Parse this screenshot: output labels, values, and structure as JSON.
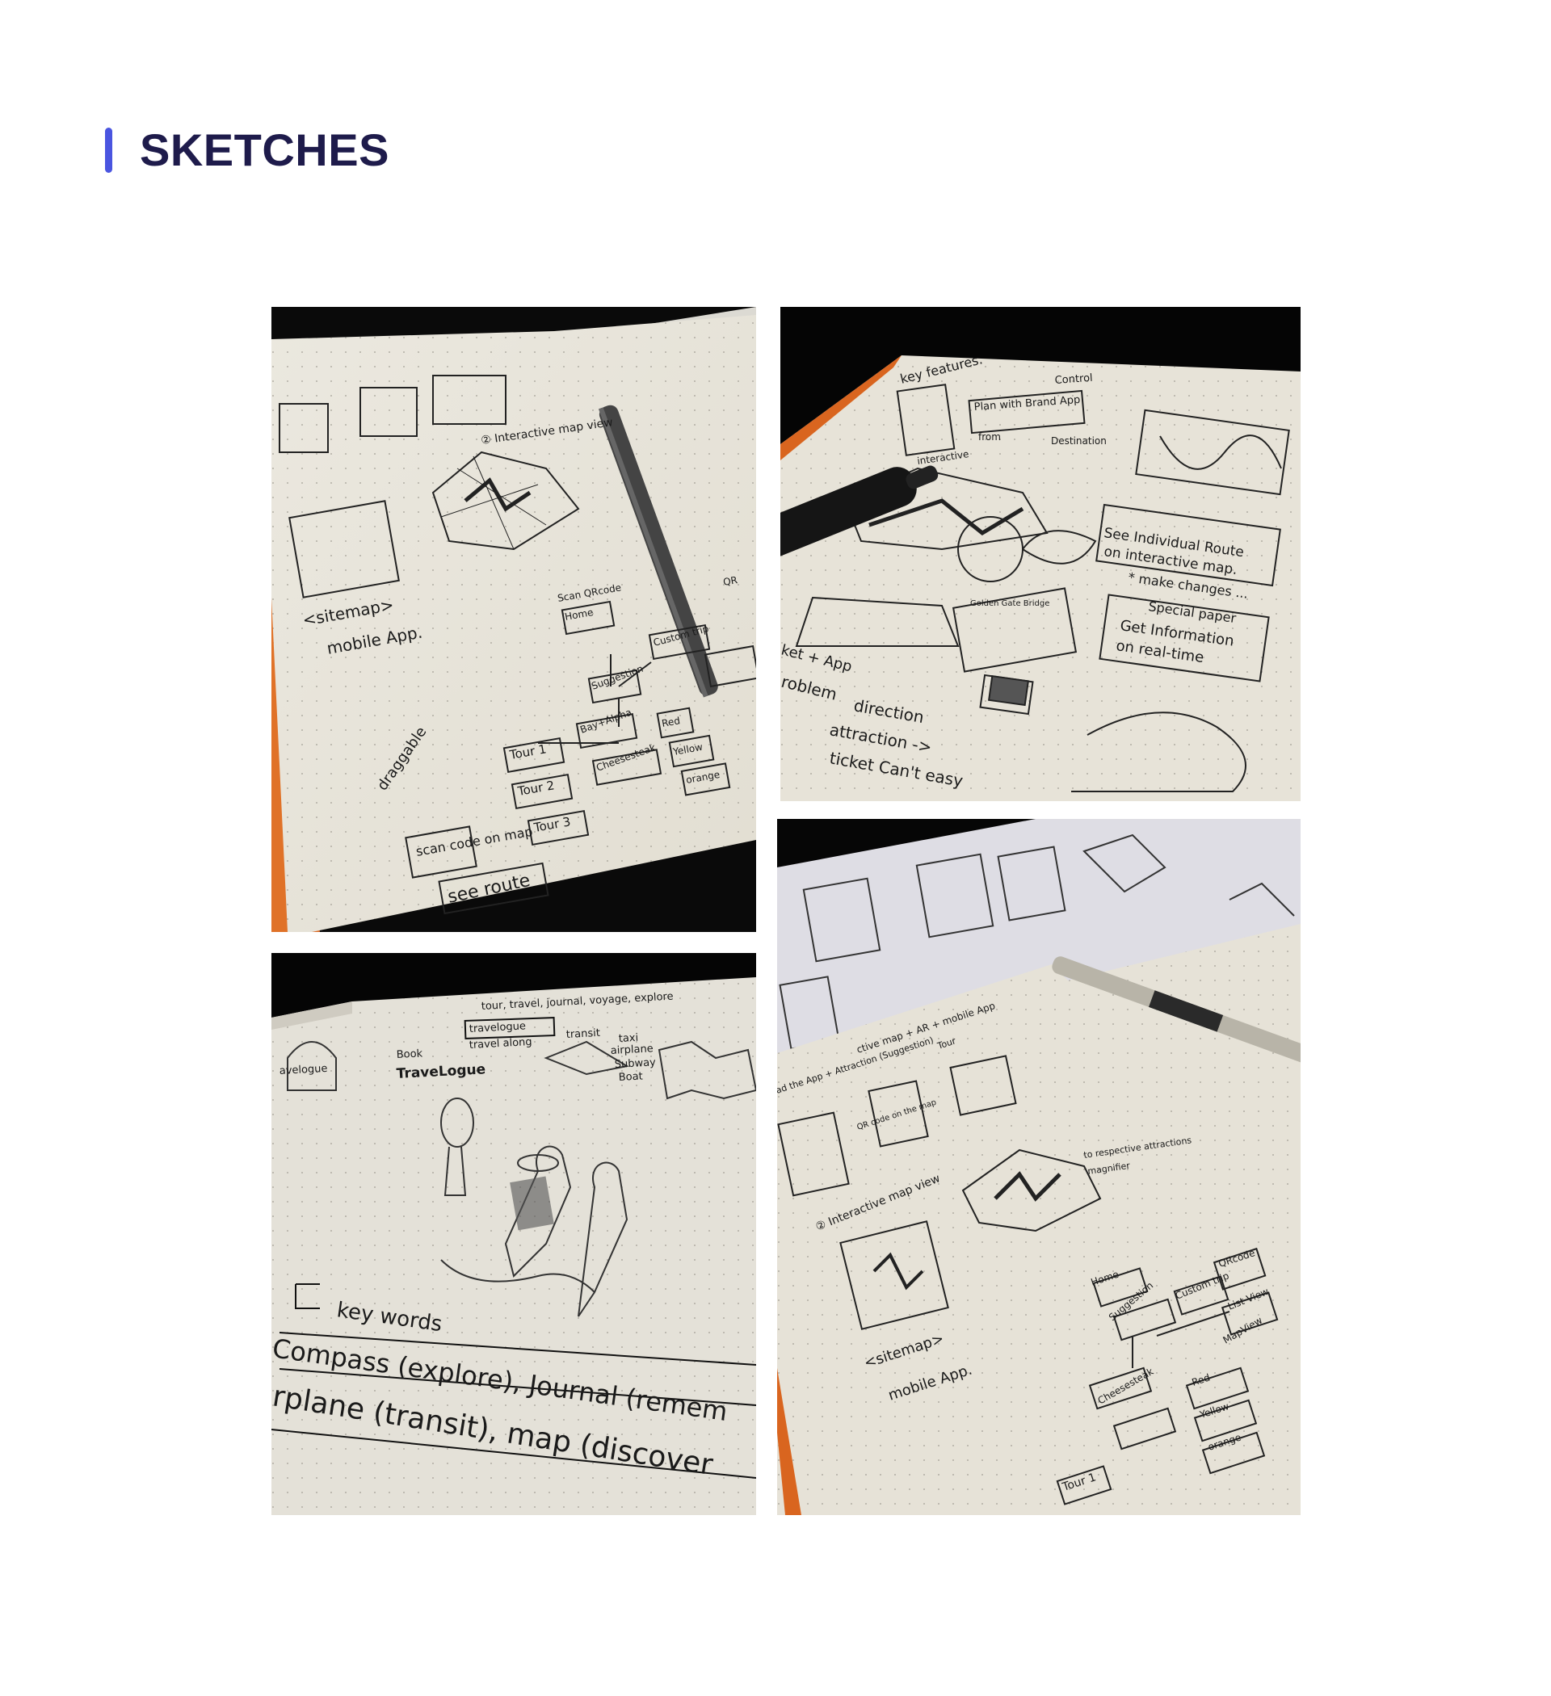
{
  "section": {
    "title": "SKETCHES",
    "accent_color": "#4a55e0",
    "title_color": "#1e1b4b"
  },
  "photos": [
    {
      "name": "sitemap-notebook-photo",
      "labels": {
        "sitemap": "<sitemap>",
        "mobile_app": "mobile App.",
        "interactive": "② Interactive map view",
        "draggable": "draggable",
        "scan_code": "scan code on map",
        "see_route": "see route",
        "home": "Home",
        "scan_qrcode": "Scan QRcode",
        "suggestion": "Suggestion",
        "custom_trip": "Custom trip",
        "tour1": "Tour 1",
        "tour2": "Tour 2",
        "tour3": "Tour 3",
        "bay": "Bay+Alpha",
        "cheese": "Cheesesteak",
        "red": "Red",
        "yellow": "Yellow",
        "orange": "orange",
        "qr": "QR"
      }
    },
    {
      "name": "key-features-notebook-photo",
      "labels": {
        "key_features": "key features.",
        "plan": "Plan with Brand App",
        "control": "Control",
        "from": "from",
        "destination": "Destination",
        "interactive": "interactive",
        "see_route": "See Individual Route",
        "on_map": "on interactive map.",
        "make_changes": "* make changes ...",
        "special_paper": "Special paper",
        "get_info": "Get Information",
        "real_time": "on real-time",
        "golden": "Golden Gate Bridge",
        "ticket": "ket + App",
        "problem": "roblem",
        "direction": "direction",
        "attraction": "attraction ->",
        "ticket_cant": "ticket Can't  easy"
      }
    },
    {
      "name": "keywords-notebook-photo",
      "labels": {
        "line1": "tour, travel, journal, voyage, explore",
        "travelogue_box": "travelogue",
        "travel_along": "travel along",
        "transit": "transit",
        "taxi": "taxi",
        "airplane": "airplane",
        "subway": "Subway",
        "boat": "Boat",
        "book": "Book",
        "travelogue": "TraveLogue",
        "avelogue": "avelogue",
        "key_words": "key words",
        "compass": "Compass (explore), Journal (remem",
        "airplane_transit": "rplane (transit), map (discover"
      }
    },
    {
      "name": "overview-notebook-photo",
      "labels": {
        "ar_app": "ctive map + AR + mobile App",
        "station": "ad the App + Attraction (Suggestion)",
        "tour": "Tour",
        "qr": "QR code on the map",
        "interactive": "② Interactive map view",
        "respective": "to respective attractions",
        "magnifier": "magnifier",
        "sitemap": "<sitemap>",
        "mobile_app": "mobile App.",
        "home": "Home",
        "suggestion": "Suggestion",
        "custom_trip": "Custom trip",
        "tour1": "Tour 1",
        "red": "Red",
        "yellow": "Yellow",
        "orange": "orange",
        "cheese": "Cheesesteak",
        "qrcode": "QRcode",
        "listview": "List View",
        "mapview": "MapView"
      }
    }
  ]
}
